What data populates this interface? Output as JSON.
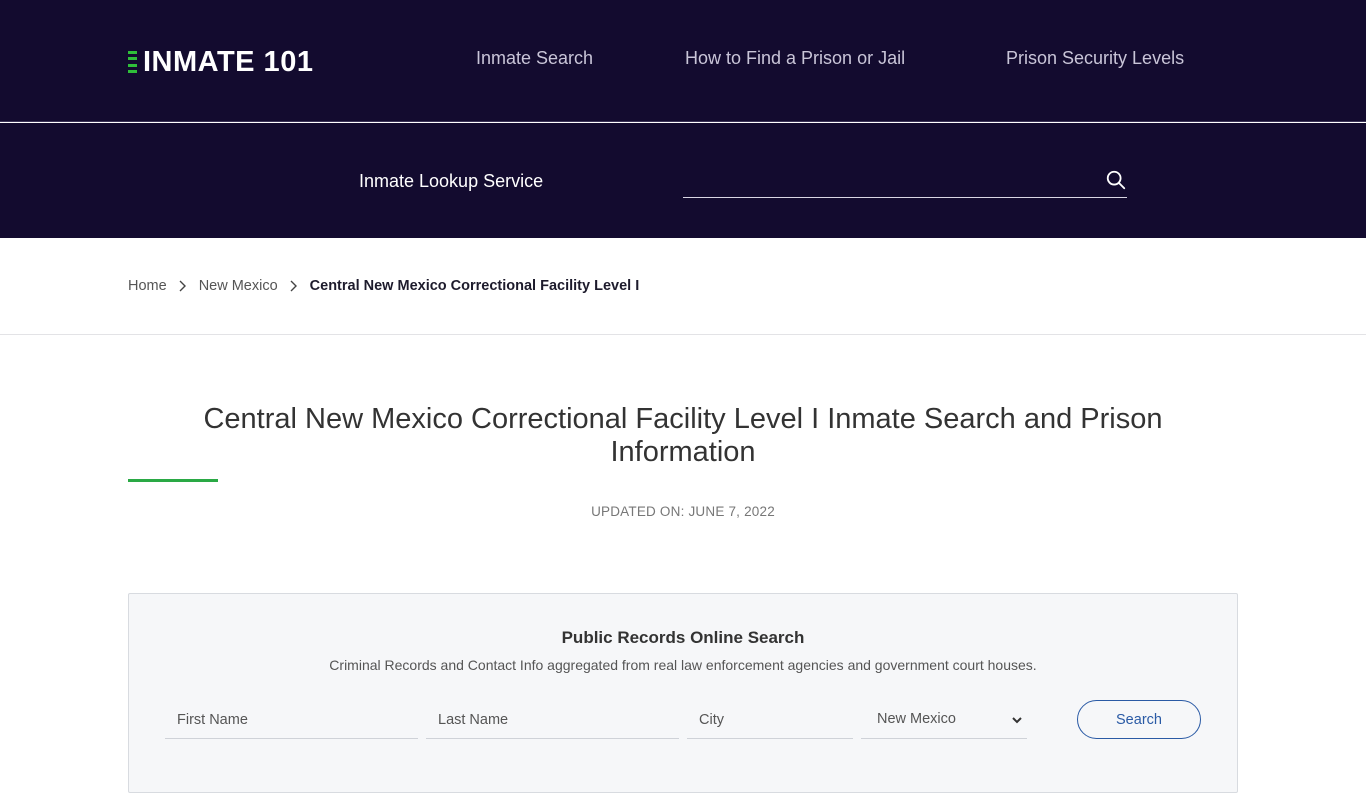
{
  "header": {
    "logo_text": "INMATE 101",
    "nav": [
      {
        "label": "Inmate Search"
      },
      {
        "label": "How to Find a Prison or Jail"
      },
      {
        "label": "Prison Security Levels"
      }
    ]
  },
  "lookup": {
    "label": "Inmate Lookup Service",
    "input_value": "",
    "placeholder": ""
  },
  "breadcrumb": {
    "items": [
      {
        "label": "Home"
      },
      {
        "label": "New Mexico"
      },
      {
        "label": "Central New Mexico Correctional Facility Level I"
      }
    ]
  },
  "page": {
    "title": "Central New Mexico Correctional Facility Level I Inmate Search and Prison Information",
    "updated": "UPDATED ON: JUNE 7, 2022"
  },
  "records_search": {
    "title": "Public Records Online Search",
    "subtitle": "Criminal Records and Contact Info aggregated from real law enforcement agencies and government court houses.",
    "first_name_placeholder": "First Name",
    "last_name_placeholder": "Last Name",
    "city_placeholder": "City",
    "state_selected": "New Mexico",
    "search_label": "Search"
  },
  "colors": {
    "header_bg": "#130b2f",
    "accent_green": "#2aa945",
    "button_blue": "#2a5aa5"
  }
}
